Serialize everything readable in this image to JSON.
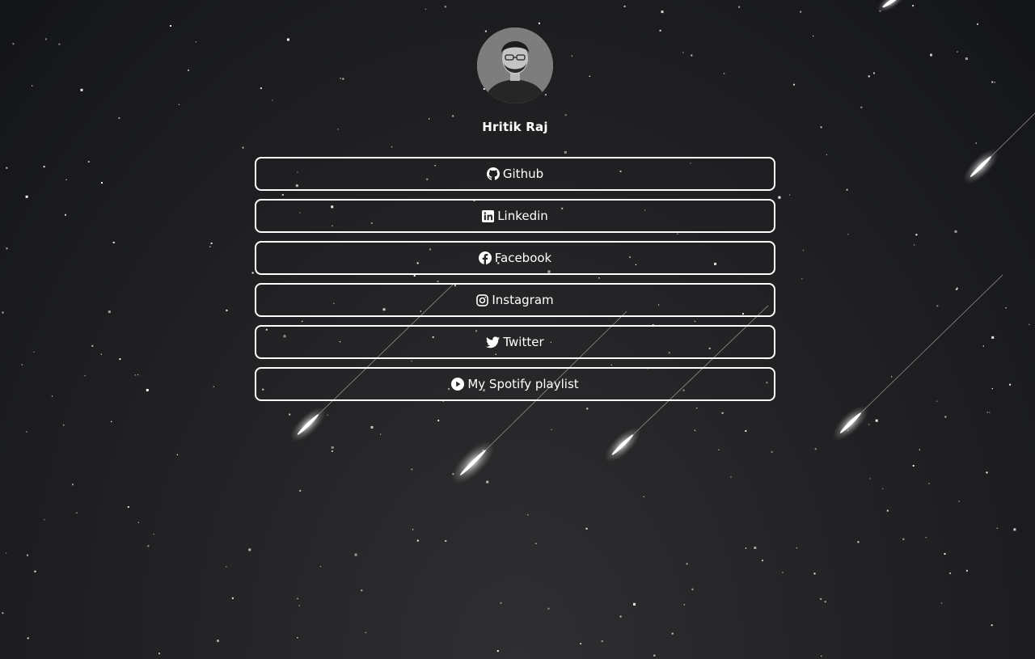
{
  "profile": {
    "name": "Hritik Raj",
    "avatar": "profile-photo"
  },
  "links": [
    {
      "label": "Github",
      "icon": "github-icon"
    },
    {
      "label": "Linkedin",
      "icon": "linkedin-icon"
    },
    {
      "label": "Facebook",
      "icon": "facebook-icon"
    },
    {
      "label": "Instagram",
      "icon": "instagram-icon"
    },
    {
      "label": "Twitter",
      "icon": "twitter-icon"
    },
    {
      "label": "My Spotify playlist",
      "icon": "play-circle-icon"
    }
  ],
  "colors": {
    "background_top": "#141519",
    "background_bottom": "#2f2f31",
    "button_border": "#ffffff",
    "text": "#ffffff"
  }
}
